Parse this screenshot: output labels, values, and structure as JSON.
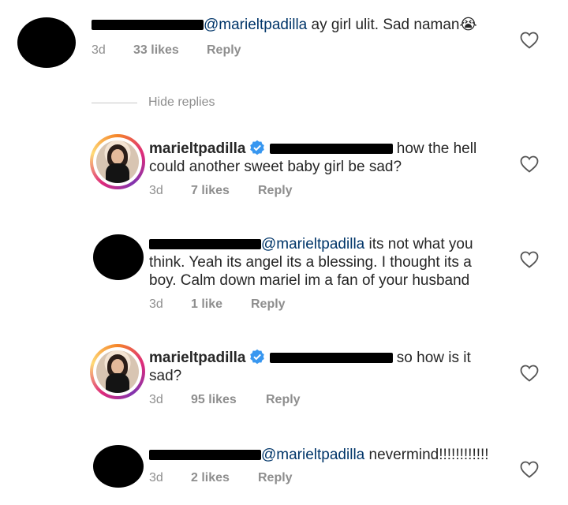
{
  "comments": [
    {
      "mention": "@marieltpadilla",
      "text": " ay girl ulit. Sad naman",
      "emoji": "😭",
      "time": "3d",
      "likes": "33 likes",
      "reply": "Reply"
    }
  ],
  "hide_replies": "Hide replies",
  "replies": [
    {
      "username": "marieltpadilla",
      "line1_after": " how the hell",
      "line2": "could another sweet baby girl be sad?",
      "time": "3d",
      "likes": "7 likes",
      "reply": "Reply"
    },
    {
      "mention": "@marieltpadilla",
      "line1_after": " its not what you",
      "line2": "think. Yeah its angel its a blessing. I thought its a",
      "line3": "boy. Calm down mariel im a fan of your husband",
      "time": "3d",
      "likes": "1 like",
      "reply": "Reply"
    },
    {
      "username": "marieltpadilla",
      "line1_after": " so how is it",
      "line2": "sad?",
      "time": "3d",
      "likes": "95 likes",
      "reply": "Reply"
    },
    {
      "mention": "@marieltpadilla",
      "text": " nevermind!!!!!!!!!!!!",
      "time": "3d",
      "likes": "2 likes",
      "reply": "Reply"
    }
  ],
  "icons": {
    "heart": "heart-outline-icon",
    "verified": "verified-badge-icon"
  },
  "colors": {
    "mention": "#003569",
    "meta": "#8e8e8e",
    "verified": "#3897f0"
  }
}
